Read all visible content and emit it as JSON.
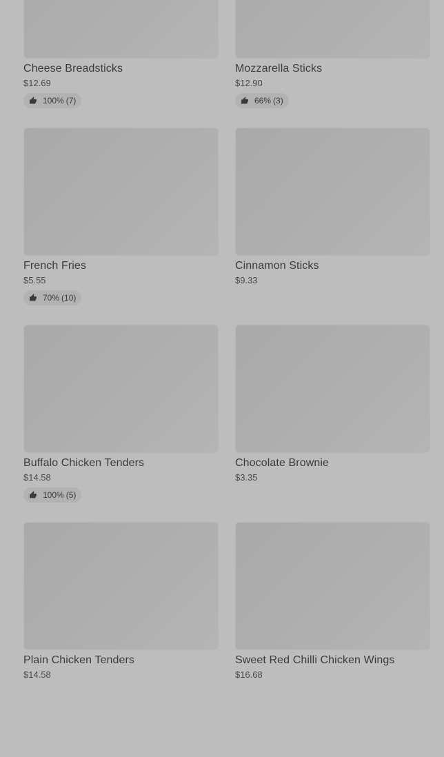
{
  "menu": {
    "items": [
      {
        "name": "Cheese Breadsticks",
        "price": "$12.69",
        "rating": {
          "percent": "100%",
          "count": "(7)"
        }
      },
      {
        "name": "Mozzarella Sticks",
        "price": "$12.90",
        "rating": {
          "percent": "66%",
          "count": "(3)"
        }
      },
      {
        "name": "French Fries",
        "price": "$5.55",
        "rating": {
          "percent": "70%",
          "count": "(10)"
        }
      },
      {
        "name": "Cinnamon Sticks",
        "price": "$9.33",
        "rating": null
      },
      {
        "name": "Buffalo Chicken Tenders",
        "price": "$14.58",
        "rating": {
          "percent": "100%",
          "count": "(5)"
        }
      },
      {
        "name": "Chocolate Brownie",
        "price": "$3.35",
        "rating": null
      },
      {
        "name": "Plain Chicken Tenders",
        "price": "$14.58",
        "rating": null
      },
      {
        "name": "Sweet Red Chilli Chicken Wings",
        "price": "$16.68",
        "rating": null
      }
    ]
  },
  "icons": {
    "rating": "thumbs-up-icon"
  },
  "colors": {
    "background": "#bdbdbd",
    "thumbnail": "#acacac",
    "text": "#3a3a3a"
  }
}
